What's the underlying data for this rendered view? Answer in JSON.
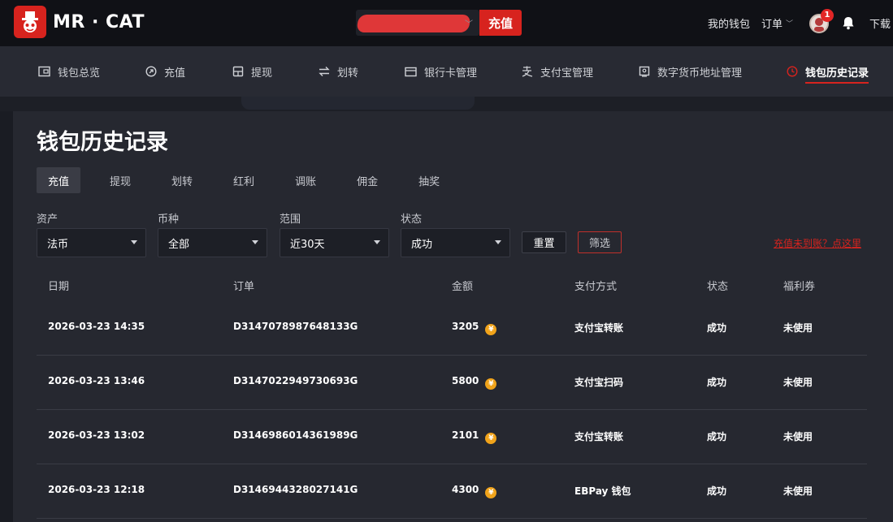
{
  "header": {
    "brand": "MR · CAT",
    "recharge_button": "充值",
    "links": {
      "wallet": "我的钱包",
      "orders": "订单",
      "download": "下载"
    },
    "notification_count": "1"
  },
  "nav": {
    "items": [
      {
        "label": "钱包总览",
        "icon": "wallet-icon"
      },
      {
        "label": "充值",
        "icon": "recharge-icon"
      },
      {
        "label": "提现",
        "icon": "withdraw-icon"
      },
      {
        "label": "划转",
        "icon": "transfer-icon"
      },
      {
        "label": "银行卡管理",
        "icon": "bank-card-icon"
      },
      {
        "label": "支付宝管理",
        "icon": "alipay-icon"
      },
      {
        "label": "数字货币地址管理",
        "icon": "crypto-address-icon"
      },
      {
        "label": "钱包历史记录",
        "icon": "history-icon",
        "active": true
      }
    ]
  },
  "page": {
    "title": "钱包历史记录",
    "tabs": [
      "充值",
      "提现",
      "划转",
      "红利",
      "调账",
      "佣金",
      "抽奖"
    ],
    "active_tab": "充值"
  },
  "filters": {
    "asset": {
      "label": "资产",
      "value": "法币"
    },
    "currency": {
      "label": "币种",
      "value": "全部"
    },
    "range": {
      "label": "范围",
      "value": "近30天"
    },
    "status": {
      "label": "状态",
      "value": "成功"
    },
    "reset_button": "重置",
    "filter_button": "筛选",
    "help_link": "充值未到账？点这里"
  },
  "table": {
    "headers": [
      "日期",
      "订单",
      "金额",
      "支付方式",
      "状态",
      "福利券"
    ],
    "rows": [
      {
        "date": "2026-03-23 14:35",
        "order": "D3147078987648133G",
        "amount": "3205",
        "method": "支付宝转账",
        "status": "成功",
        "coupon": "未使用"
      },
      {
        "date": "2026-03-23 13:46",
        "order": "D3147022949730693G",
        "amount": "5800",
        "method": "支付宝扫码",
        "status": "成功",
        "coupon": "未使用"
      },
      {
        "date": "2026-03-23 13:02",
        "order": "D3146986014361989G",
        "amount": "2101",
        "method": "支付宝转账",
        "status": "成功",
        "coupon": "未使用"
      },
      {
        "date": "2026-03-23 12:18",
        "order": "D3146944328027141G",
        "amount": "4300",
        "method": "EBPay 钱包",
        "status": "成功",
        "coupon": "未使用"
      }
    ]
  },
  "colors": {
    "accent": "#d7231e",
    "coin": "#f0a31a"
  }
}
